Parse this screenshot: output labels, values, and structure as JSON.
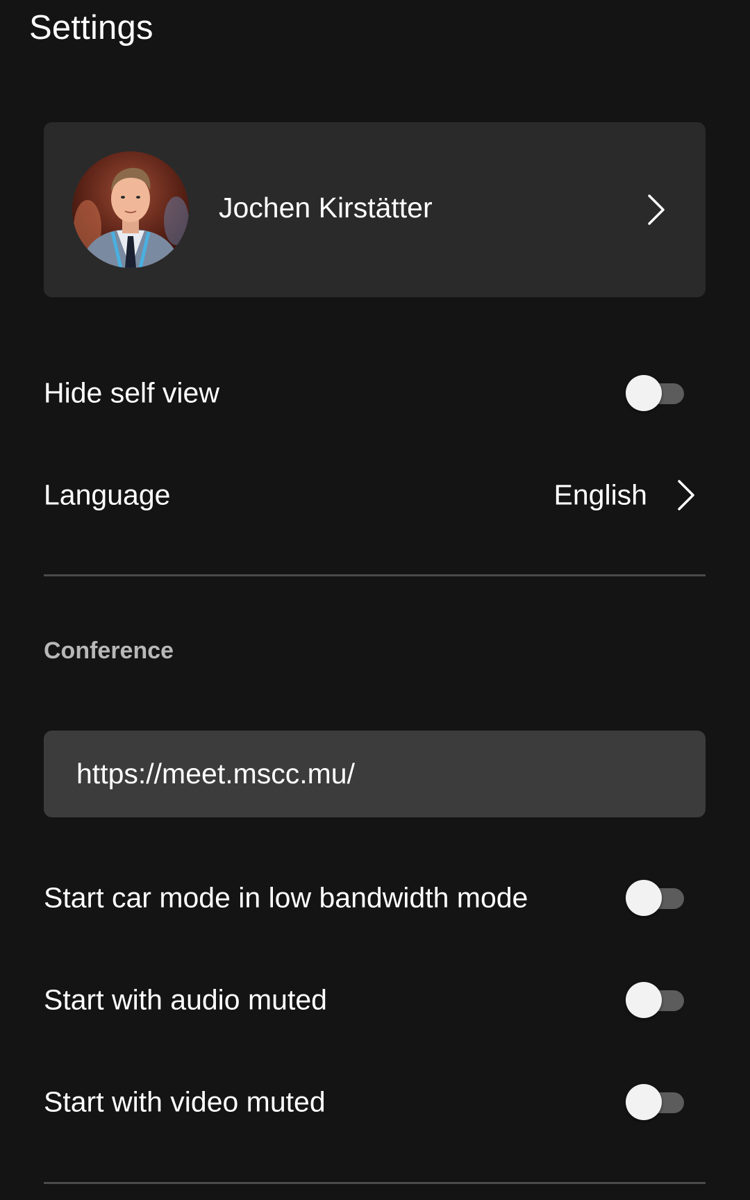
{
  "header": {
    "title": "Settings"
  },
  "profile": {
    "name": "Jochen Kirstätter",
    "avatar_icon": "user-avatar-photo",
    "chevron_icon": "chevron-right-icon"
  },
  "general": {
    "hide_self_view": {
      "label": "Hide self view",
      "enabled": false
    },
    "language": {
      "label": "Language",
      "value": "English",
      "chevron_icon": "chevron-right-icon"
    }
  },
  "conference": {
    "section_title": "Conference",
    "server_url": "https://meet.mscc.mu/",
    "toggles": [
      {
        "label": "Start car mode in low bandwidth mode",
        "enabled": false
      },
      {
        "label": "Start with audio muted",
        "enabled": false
      },
      {
        "label": "Start with video muted",
        "enabled": false
      }
    ]
  },
  "colors": {
    "background": "#141414",
    "card": "#2a2a2a",
    "input": "#3c3c3c",
    "text_primary": "#ffffff",
    "text_secondary": "#b8b8b8",
    "divider": "#4a4a4a",
    "toggle_track_off": "#5c5c5c",
    "toggle_thumb": "#f2f2f2"
  }
}
